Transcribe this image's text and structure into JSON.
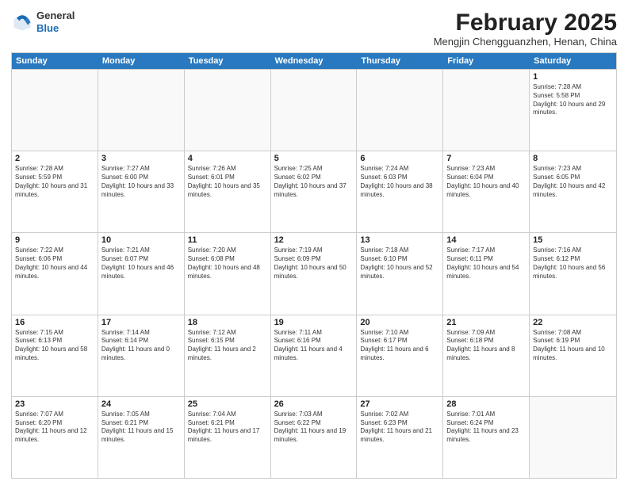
{
  "header": {
    "logo_line1": "General",
    "logo_line2": "Blue",
    "month_year": "February 2025",
    "location": "Mengjin Chengguanzhen, Henan, China"
  },
  "days_of_week": [
    "Sunday",
    "Monday",
    "Tuesday",
    "Wednesday",
    "Thursday",
    "Friday",
    "Saturday"
  ],
  "weeks": [
    [
      {
        "day": "",
        "empty": true
      },
      {
        "day": "",
        "empty": true
      },
      {
        "day": "",
        "empty": true
      },
      {
        "day": "",
        "empty": true
      },
      {
        "day": "",
        "empty": true
      },
      {
        "day": "",
        "empty": true
      },
      {
        "day": "1",
        "sunrise": "7:28 AM",
        "sunset": "5:58 PM",
        "daylight": "10 hours and 29 minutes."
      }
    ],
    [
      {
        "day": "2",
        "sunrise": "7:28 AM",
        "sunset": "5:59 PM",
        "daylight": "10 hours and 31 minutes."
      },
      {
        "day": "3",
        "sunrise": "7:27 AM",
        "sunset": "6:00 PM",
        "daylight": "10 hours and 33 minutes."
      },
      {
        "day": "4",
        "sunrise": "7:26 AM",
        "sunset": "6:01 PM",
        "daylight": "10 hours and 35 minutes."
      },
      {
        "day": "5",
        "sunrise": "7:25 AM",
        "sunset": "6:02 PM",
        "daylight": "10 hours and 37 minutes."
      },
      {
        "day": "6",
        "sunrise": "7:24 AM",
        "sunset": "6:03 PM",
        "daylight": "10 hours and 38 minutes."
      },
      {
        "day": "7",
        "sunrise": "7:23 AM",
        "sunset": "6:04 PM",
        "daylight": "10 hours and 40 minutes."
      },
      {
        "day": "8",
        "sunrise": "7:23 AM",
        "sunset": "6:05 PM",
        "daylight": "10 hours and 42 minutes."
      }
    ],
    [
      {
        "day": "9",
        "sunrise": "7:22 AM",
        "sunset": "6:06 PM",
        "daylight": "10 hours and 44 minutes."
      },
      {
        "day": "10",
        "sunrise": "7:21 AM",
        "sunset": "6:07 PM",
        "daylight": "10 hours and 46 minutes."
      },
      {
        "day": "11",
        "sunrise": "7:20 AM",
        "sunset": "6:08 PM",
        "daylight": "10 hours and 48 minutes."
      },
      {
        "day": "12",
        "sunrise": "7:19 AM",
        "sunset": "6:09 PM",
        "daylight": "10 hours and 50 minutes."
      },
      {
        "day": "13",
        "sunrise": "7:18 AM",
        "sunset": "6:10 PM",
        "daylight": "10 hours and 52 minutes."
      },
      {
        "day": "14",
        "sunrise": "7:17 AM",
        "sunset": "6:11 PM",
        "daylight": "10 hours and 54 minutes."
      },
      {
        "day": "15",
        "sunrise": "7:16 AM",
        "sunset": "6:12 PM",
        "daylight": "10 hours and 56 minutes."
      }
    ],
    [
      {
        "day": "16",
        "sunrise": "7:15 AM",
        "sunset": "6:13 PM",
        "daylight": "10 hours and 58 minutes."
      },
      {
        "day": "17",
        "sunrise": "7:14 AM",
        "sunset": "6:14 PM",
        "daylight": "11 hours and 0 minutes."
      },
      {
        "day": "18",
        "sunrise": "7:12 AM",
        "sunset": "6:15 PM",
        "daylight": "11 hours and 2 minutes."
      },
      {
        "day": "19",
        "sunrise": "7:11 AM",
        "sunset": "6:16 PM",
        "daylight": "11 hours and 4 minutes."
      },
      {
        "day": "20",
        "sunrise": "7:10 AM",
        "sunset": "6:17 PM",
        "daylight": "11 hours and 6 minutes."
      },
      {
        "day": "21",
        "sunrise": "7:09 AM",
        "sunset": "6:18 PM",
        "daylight": "11 hours and 8 minutes."
      },
      {
        "day": "22",
        "sunrise": "7:08 AM",
        "sunset": "6:19 PM",
        "daylight": "11 hours and 10 minutes."
      }
    ],
    [
      {
        "day": "23",
        "sunrise": "7:07 AM",
        "sunset": "6:20 PM",
        "daylight": "11 hours and 12 minutes."
      },
      {
        "day": "24",
        "sunrise": "7:05 AM",
        "sunset": "6:21 PM",
        "daylight": "11 hours and 15 minutes."
      },
      {
        "day": "25",
        "sunrise": "7:04 AM",
        "sunset": "6:21 PM",
        "daylight": "11 hours and 17 minutes."
      },
      {
        "day": "26",
        "sunrise": "7:03 AM",
        "sunset": "6:22 PM",
        "daylight": "11 hours and 19 minutes."
      },
      {
        "day": "27",
        "sunrise": "7:02 AM",
        "sunset": "6:23 PM",
        "daylight": "11 hours and 21 minutes."
      },
      {
        "day": "28",
        "sunrise": "7:01 AM",
        "sunset": "6:24 PM",
        "daylight": "11 hours and 23 minutes."
      },
      {
        "day": "",
        "empty": true
      }
    ]
  ]
}
